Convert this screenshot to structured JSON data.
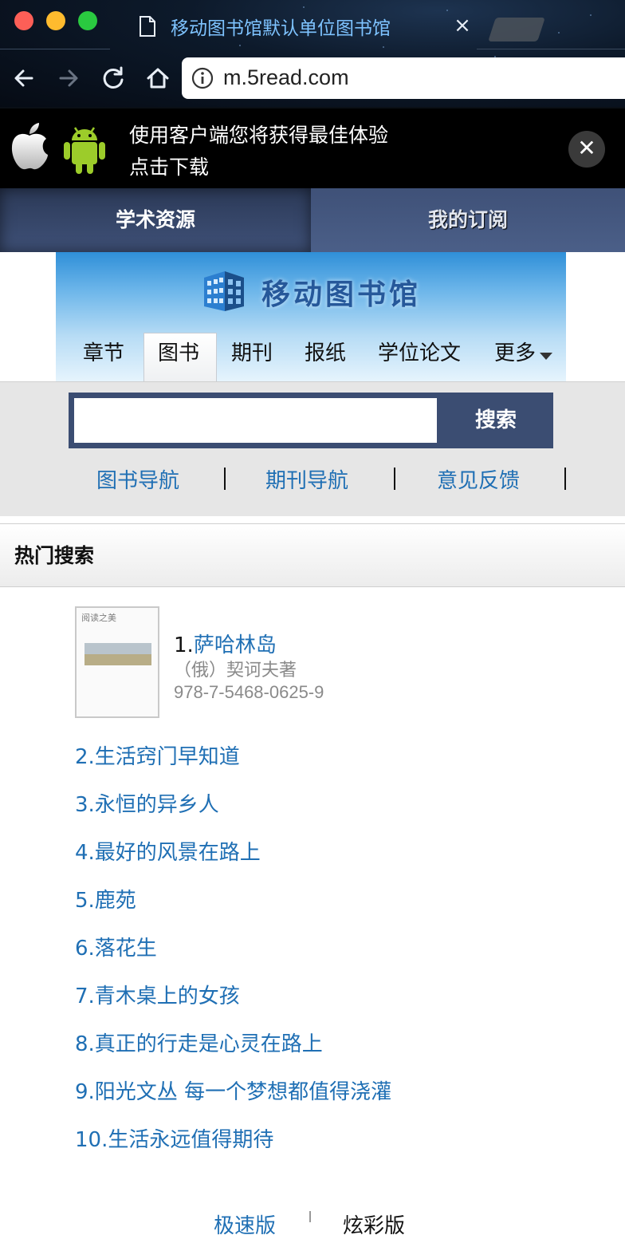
{
  "browser": {
    "tab_title": "移动图书馆默认单位图书馆",
    "tab_close": "×",
    "url": "m.5read.com"
  },
  "banner": {
    "line1": "使用客户端您将获得最佳体验",
    "line2": "点击下载",
    "close": "✕"
  },
  "top_tabs": {
    "academic": "学术资源",
    "subscription": "我的订阅"
  },
  "logo": {
    "text": "移动图书馆"
  },
  "categories": [
    "章节",
    "图书",
    "期刊",
    "报纸",
    "学位论文",
    "更多"
  ],
  "search": {
    "value": "",
    "button": "搜索"
  },
  "quick_links": [
    "图书导航",
    "期刊导航",
    "意见反馈"
  ],
  "hot": {
    "title": "热门搜索",
    "first": {
      "num": "1.",
      "title": "萨哈林岛",
      "author": "（俄）契诃夫著",
      "isbn": "978-7-5468-0625-9",
      "cover_brand": "阅读之美"
    },
    "items": [
      "2.生活窍门早知道",
      "3.永恒的异乡人",
      "4.最好的风景在路上",
      "5.鹿苑",
      "6.落花生",
      "7.青木桌上的女孩",
      "8.真正的行走是心灵在路上",
      "9.阳光文丛 每一个梦想都值得浇灌",
      "10.生活永远值得期待"
    ]
  },
  "footer": {
    "lite": "极速版",
    "color": "炫彩版"
  },
  "colors": {
    "link": "#1f6fb4",
    "nav_dark": "#3b4d72",
    "banner_bg": "#000000"
  }
}
